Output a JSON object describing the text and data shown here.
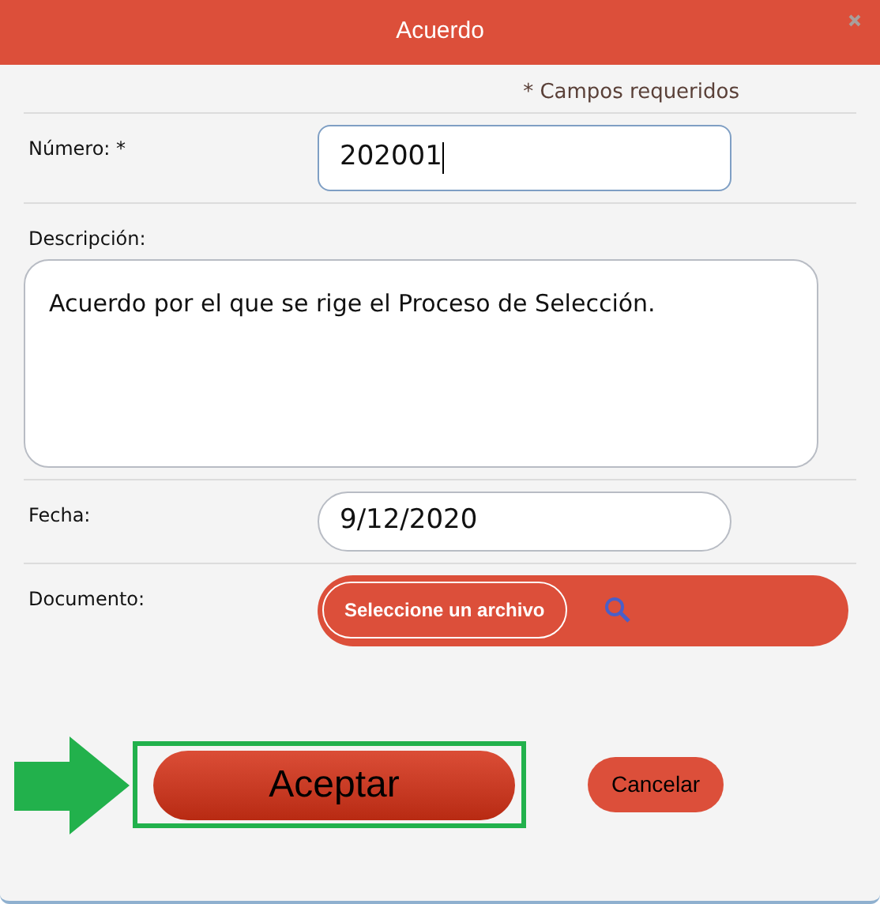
{
  "window": {
    "title": "Acuerdo"
  },
  "required_note": "* Campos requeridos",
  "fields": [
    {
      "kind": "input",
      "label": "Número: *",
      "value": "202001",
      "focused": true
    },
    {
      "kind": "textarea",
      "label": "Descripción:",
      "value": "Acuerdo por el que se rige el Proceso de Selección."
    },
    {
      "kind": "date",
      "label": "Fecha:",
      "value": "9/12/2020"
    },
    {
      "kind": "file",
      "label": "Documento:",
      "button": "Seleccione un archivo"
    }
  ],
  "buttons": [
    {
      "label": "Aceptar",
      "kind": "primary",
      "highlighted": true
    },
    {
      "label": "Cancelar",
      "kind": "secondary",
      "highlighted": false
    }
  ]
}
